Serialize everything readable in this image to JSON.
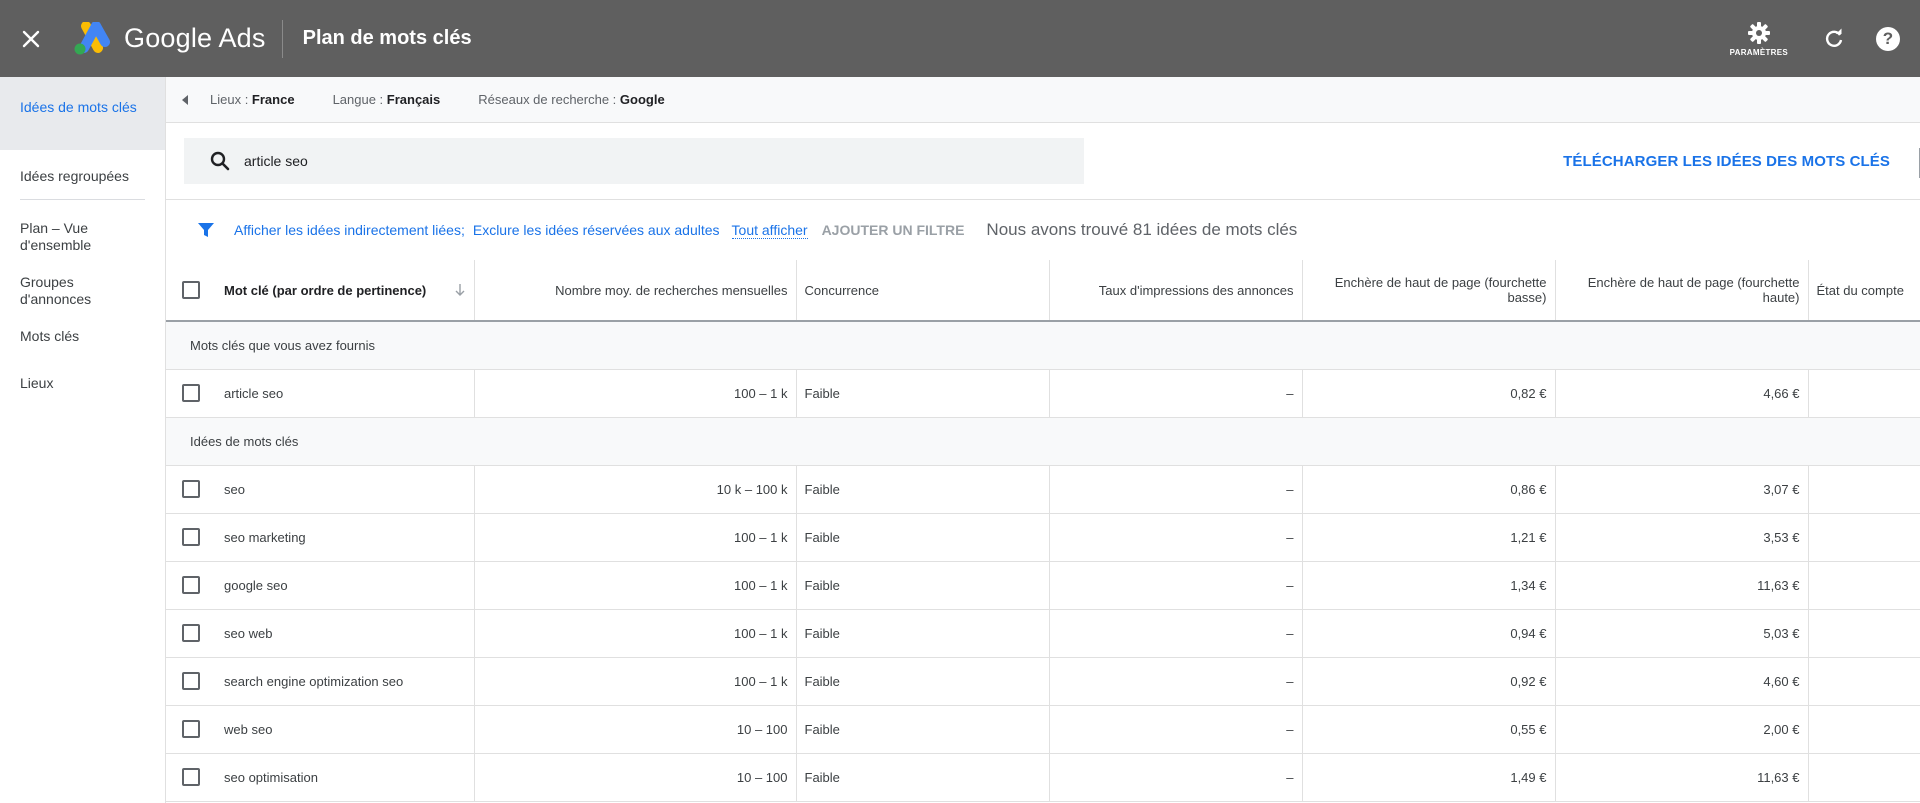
{
  "topbar": {
    "brand": "Google Ads",
    "title": "Plan de mots clés",
    "settings_label": "PARAMÈTRES",
    "help_label": "?"
  },
  "sidebar": {
    "items": [
      {
        "label": "Idées de mots clés",
        "active": true
      },
      {
        "label": "Idées regroupées"
      },
      {
        "label": "Plan – Vue d'ensemble"
      },
      {
        "label": "Groupes d'annonces"
      },
      {
        "label": "Mots clés"
      },
      {
        "label": "Lieux"
      }
    ]
  },
  "crumbs": {
    "location_label": "Lieux : ",
    "location_value": "France",
    "language_label": "Langue : ",
    "language_value": "Français",
    "network_label": "Réseaux de recherche : ",
    "network_value": "Google"
  },
  "search": {
    "value": "article seo",
    "download_label": "TÉLÉCHARGER LES IDÉES DES MOTS CLÉS"
  },
  "filters": {
    "indirect": "Afficher les idées indirectement liées;",
    "adult": "Exclure les idées réservées aux adultes",
    "show_all": "Tout afficher",
    "add_filter": "AJOUTER UN FILTRE",
    "found": "Nous avons trouvé 81 idées de mots clés"
  },
  "table": {
    "columns": [
      "Mot clé (par ordre de pertinence)",
      "Nombre moy. de recherches mensuelles",
      "Concurrence",
      "Taux d'impressions des annonces",
      "Enchère de haut de page (fourchette basse)",
      "Enchère de haut de page (fourchette haute)",
      "État du compte"
    ],
    "group_provided": "Mots clés que vous avez fournis",
    "group_ideas": "Idées de mots clés",
    "provided": [
      {
        "keyword": "article seo",
        "volume": "100 – 1 k",
        "competition": "Faible",
        "impressions": "–",
        "low": "0,82 €",
        "high": "4,66 €",
        "status": ""
      }
    ],
    "ideas": [
      {
        "keyword": "seo",
        "volume": "10 k – 100 k",
        "competition": "Faible",
        "impressions": "–",
        "low": "0,86 €",
        "high": "3,07 €",
        "status": ""
      },
      {
        "keyword": "seo marketing",
        "volume": "100 – 1 k",
        "competition": "Faible",
        "impressions": "–",
        "low": "1,21 €",
        "high": "3,53 €",
        "status": ""
      },
      {
        "keyword": "google seo",
        "volume": "100 – 1 k",
        "competition": "Faible",
        "impressions": "–",
        "low": "1,34 €",
        "high": "11,63 €",
        "status": ""
      },
      {
        "keyword": "seo web",
        "volume": "100 – 1 k",
        "competition": "Faible",
        "impressions": "–",
        "low": "0,94 €",
        "high": "5,03 €",
        "status": ""
      },
      {
        "keyword": "search engine optimization seo",
        "volume": "100 – 1 k",
        "competition": "Faible",
        "impressions": "–",
        "low": "0,92 €",
        "high": "4,60 €",
        "status": ""
      },
      {
        "keyword": "web seo",
        "volume": "10 – 100",
        "competition": "Faible",
        "impressions": "–",
        "low": "0,55 €",
        "high": "2,00 €",
        "status": ""
      },
      {
        "keyword": "seo optimisation",
        "volume": "10 – 100",
        "competition": "Faible",
        "impressions": "–",
        "low": "1,49 €",
        "high": "11,63 €",
        "status": ""
      }
    ]
  },
  "colors": {
    "topbar": "#5f5f5f",
    "accent": "#1a73e8"
  }
}
